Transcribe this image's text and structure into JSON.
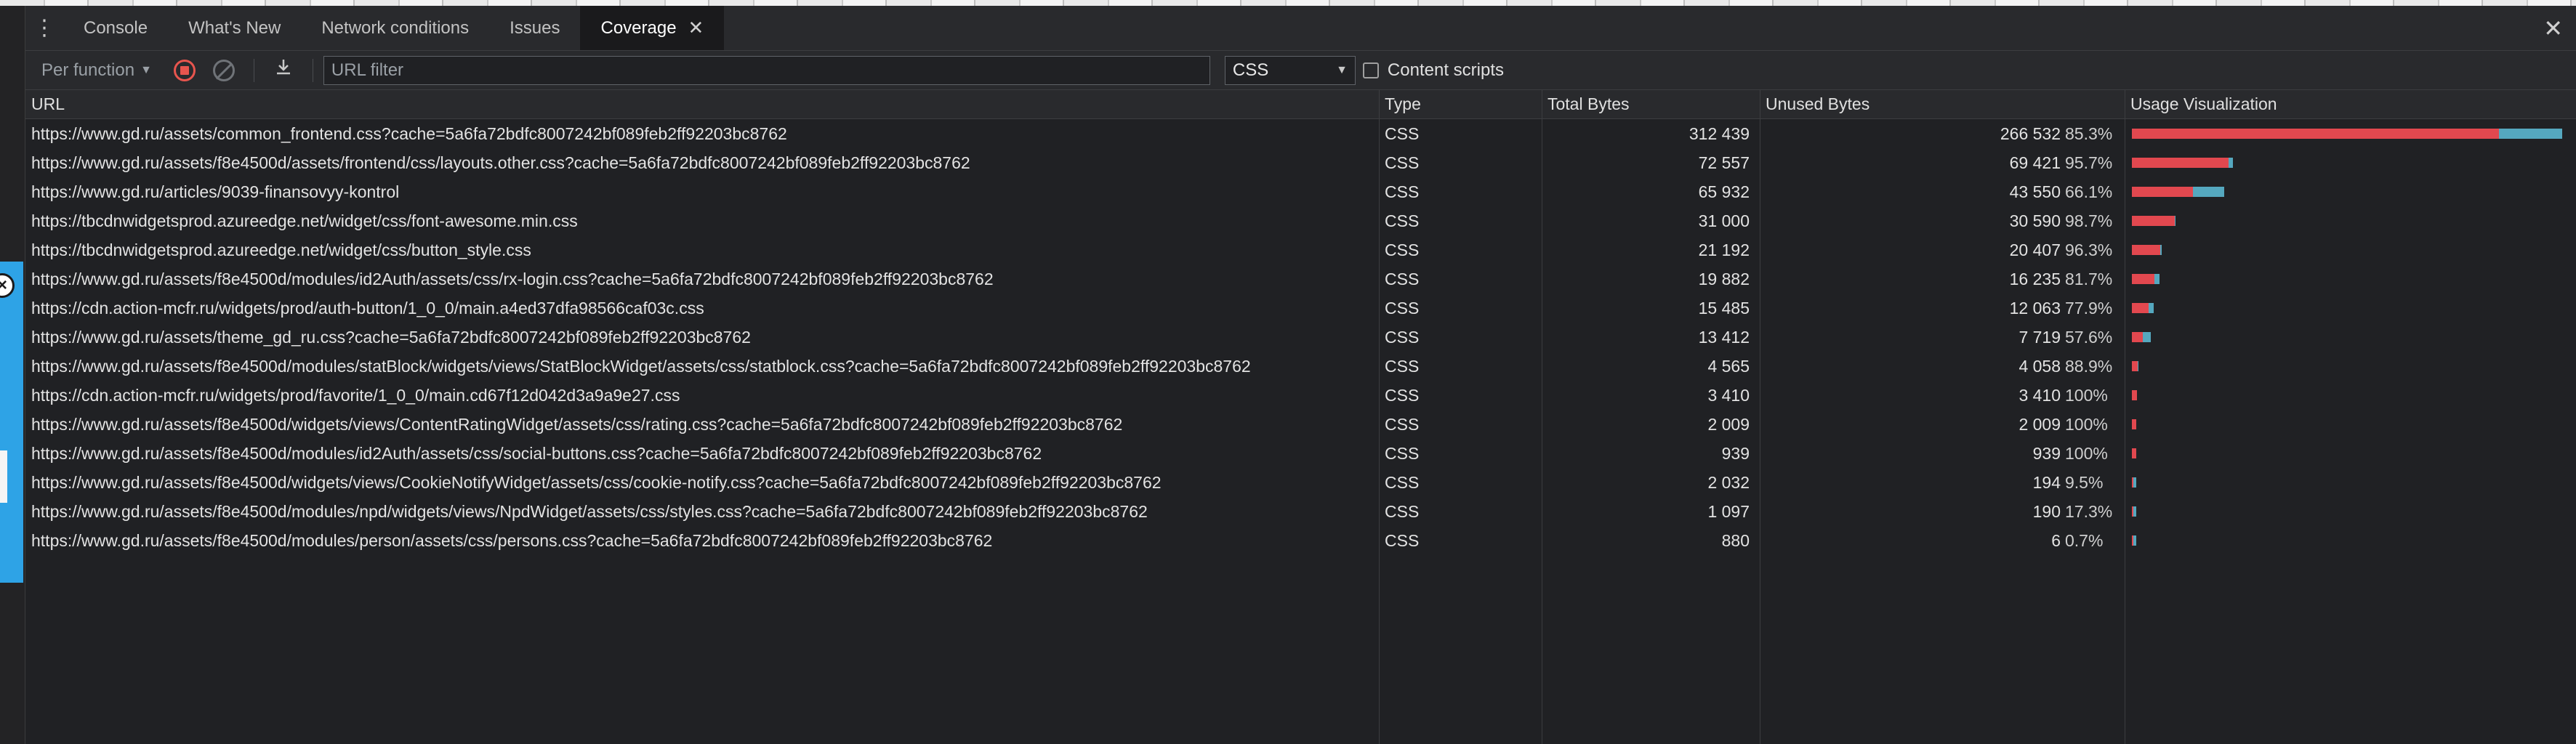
{
  "tabs": [
    {
      "label": "Console",
      "active": false
    },
    {
      "label": "What's New",
      "active": false
    },
    {
      "label": "Network conditions",
      "active": false
    },
    {
      "label": "Issues",
      "active": false
    },
    {
      "label": "Coverage",
      "active": true
    }
  ],
  "toolbar": {
    "mode_label": "Per function",
    "url_filter_placeholder": "URL filter",
    "type_filter_value": "CSS",
    "content_scripts_label": "Content scripts",
    "content_scripts_checked": false
  },
  "columns": {
    "url": "URL",
    "type": "Type",
    "total": "Total Bytes",
    "unused": "Unused Bytes",
    "vis": "Usage Visualization"
  },
  "colors": {
    "unused": "#e2484f",
    "used": "#55a8bf",
    "record": "#e8554e"
  },
  "max_total": 312439,
  "rows": [
    {
      "url": "https://www.gd.ru/assets/common_frontend.css?cache=5a6fa72bdfc8007242bf089feb2ff92203bc8762",
      "type": "CSS",
      "total": "312 439",
      "unused": "266 532",
      "pct": "85.3%",
      "total_n": 312439,
      "unused_n": 266532
    },
    {
      "url": "https://www.gd.ru/assets/f8e4500d/assets/frontend/css/layouts.other.css?cache=5a6fa72bdfc8007242bf089feb2ff92203bc8762",
      "type": "CSS",
      "total": "72 557",
      "unused": "69 421",
      "pct": "95.7%",
      "total_n": 72557,
      "unused_n": 69421
    },
    {
      "url": "https://www.gd.ru/articles/9039-finansovyy-kontrol",
      "type": "CSS",
      "total": "65 932",
      "unused": "43 550",
      "pct": "66.1%",
      "total_n": 65932,
      "unused_n": 43550
    },
    {
      "url": "https://tbcdnwidgetsprod.azureedge.net/widget/css/font-awesome.min.css",
      "type": "CSS",
      "total": "31 000",
      "unused": "30 590",
      "pct": "98.7%",
      "total_n": 31000,
      "unused_n": 30590
    },
    {
      "url": "https://tbcdnwidgetsprod.azureedge.net/widget/css/button_style.css",
      "type": "CSS",
      "total": "21 192",
      "unused": "20 407",
      "pct": "96.3%",
      "total_n": 21192,
      "unused_n": 20407
    },
    {
      "url": "https://www.gd.ru/assets/f8e4500d/modules/id2Auth/assets/css/rx-login.css?cache=5a6fa72bdfc8007242bf089feb2ff92203bc8762",
      "type": "CSS",
      "total": "19 882",
      "unused": "16 235",
      "pct": "81.7%",
      "total_n": 19882,
      "unused_n": 16235
    },
    {
      "url": "https://cdn.action-mcfr.ru/widgets/prod/auth-button/1_0_0/main.a4ed37dfa98566caf03c.css",
      "type": "CSS",
      "total": "15 485",
      "unused": "12 063",
      "pct": "77.9%",
      "total_n": 15485,
      "unused_n": 12063
    },
    {
      "url": "https://www.gd.ru/assets/theme_gd_ru.css?cache=5a6fa72bdfc8007242bf089feb2ff92203bc8762",
      "type": "CSS",
      "total": "13 412",
      "unused": "7 719",
      "pct": "57.6%",
      "total_n": 13412,
      "unused_n": 7719
    },
    {
      "url": "https://www.gd.ru/assets/f8e4500d/modules/statBlock/widgets/views/StatBlockWidget/assets/css/statblock.css?cache=5a6fa72bdfc8007242bf089feb2ff92203bc8762",
      "type": "CSS",
      "total": "4 565",
      "unused": "4 058",
      "pct": "88.9%",
      "total_n": 4565,
      "unused_n": 4058
    },
    {
      "url": "https://cdn.action-mcfr.ru/widgets/prod/favorite/1_0_0/main.cd67f12d042d3a9a9e27.css",
      "type": "CSS",
      "total": "3 410",
      "unused": "3 410",
      "pct": "100%",
      "total_n": 3410,
      "unused_n": 3410
    },
    {
      "url": "https://www.gd.ru/assets/f8e4500d/widgets/views/ContentRatingWidget/assets/css/rating.css?cache=5a6fa72bdfc8007242bf089feb2ff92203bc8762",
      "type": "CSS",
      "total": "2 009",
      "unused": "2 009",
      "pct": "100%",
      "total_n": 2009,
      "unused_n": 2009
    },
    {
      "url": "https://www.gd.ru/assets/f8e4500d/modules/id2Auth/assets/css/social-buttons.css?cache=5a6fa72bdfc8007242bf089feb2ff92203bc8762",
      "type": "CSS",
      "total": "939",
      "unused": "939",
      "pct": "100%",
      "total_n": 939,
      "unused_n": 939
    },
    {
      "url": "https://www.gd.ru/assets/f8e4500d/widgets/views/CookieNotifyWidget/assets/css/cookie-notify.css?cache=5a6fa72bdfc8007242bf089feb2ff92203bc8762",
      "type": "CSS",
      "total": "2 032",
      "unused": "194",
      "pct": "9.5%",
      "total_n": 2032,
      "unused_n": 194
    },
    {
      "url": "https://www.gd.ru/assets/f8e4500d/modules/npd/widgets/views/NpdWidget/assets/css/styles.css?cache=5a6fa72bdfc8007242bf089feb2ff92203bc8762",
      "type": "CSS",
      "total": "1 097",
      "unused": "190",
      "pct": "17.3%",
      "total_n": 1097,
      "unused_n": 190
    },
    {
      "url": "https://www.gd.ru/assets/f8e4500d/modules/person/assets/css/persons.css?cache=5a6fa72bdfc8007242bf089feb2ff92203bc8762",
      "type": "CSS",
      "total": "880",
      "unused": "6",
      "pct": "0.7%",
      "total_n": 880,
      "unused_n": 6
    }
  ]
}
